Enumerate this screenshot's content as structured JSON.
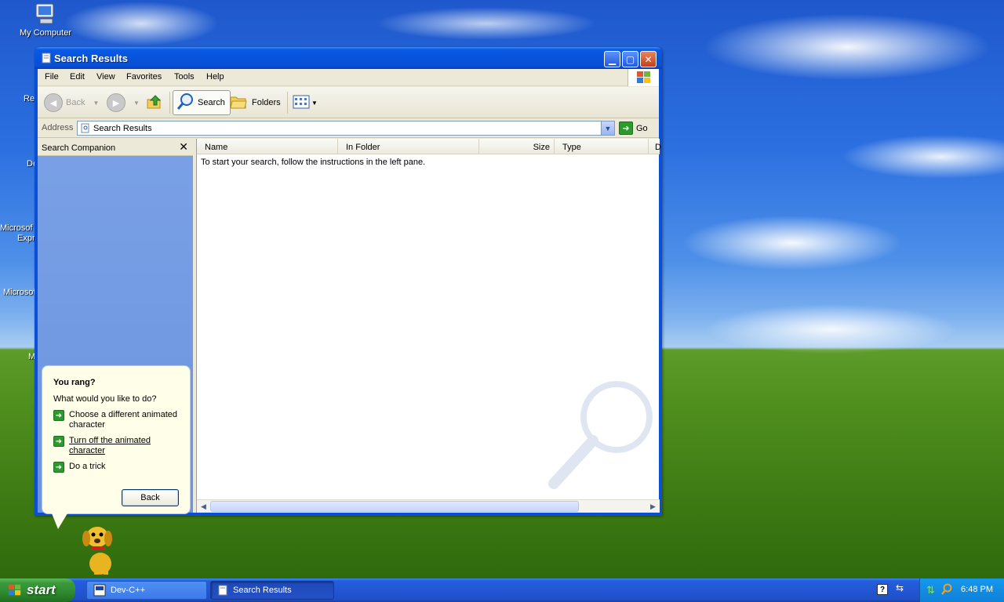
{
  "desktop": {
    "icons": [
      {
        "label": "My Computer"
      },
      {
        "label": "Re"
      },
      {
        "label": "De"
      },
      {
        "label": "Microsof"
      },
      {
        "label": "Expr"
      },
      {
        "label": "Microsof"
      },
      {
        "label": "M"
      }
    ]
  },
  "window": {
    "title": "Search Results",
    "menu": [
      "File",
      "Edit",
      "View",
      "Favorites",
      "Tools",
      "Help"
    ],
    "toolbar": {
      "back_label": "Back",
      "search_label": "Search",
      "folders_label": "Folders"
    },
    "address": {
      "label": "Address",
      "value": "Search Results",
      "go_label": "Go"
    },
    "companion": {
      "title": "Search Companion",
      "close_glyph": "✕",
      "balloon": {
        "title": "You rang?",
        "subtitle": "What would you like to do?",
        "options": [
          "Choose a different animated character",
          "Turn off the animated character",
          "Do a trick"
        ],
        "back_label": "Back"
      }
    },
    "results": {
      "columns": [
        "Name",
        "In Folder",
        "Size",
        "Type",
        "D"
      ],
      "empty_message": "To start your search, follow the instructions in the left pane."
    }
  },
  "taskbar": {
    "start_label": "start",
    "tasks": [
      {
        "label": "Dev-C++",
        "active": false
      },
      {
        "label": "Search Results",
        "active": true
      }
    ],
    "clock": "6:48 PM"
  },
  "colors": {
    "titlebar": "#0753dc",
    "companion_bg": "#7aa1e6",
    "taskbar": "#245edc",
    "start": "#3a9a3a"
  }
}
